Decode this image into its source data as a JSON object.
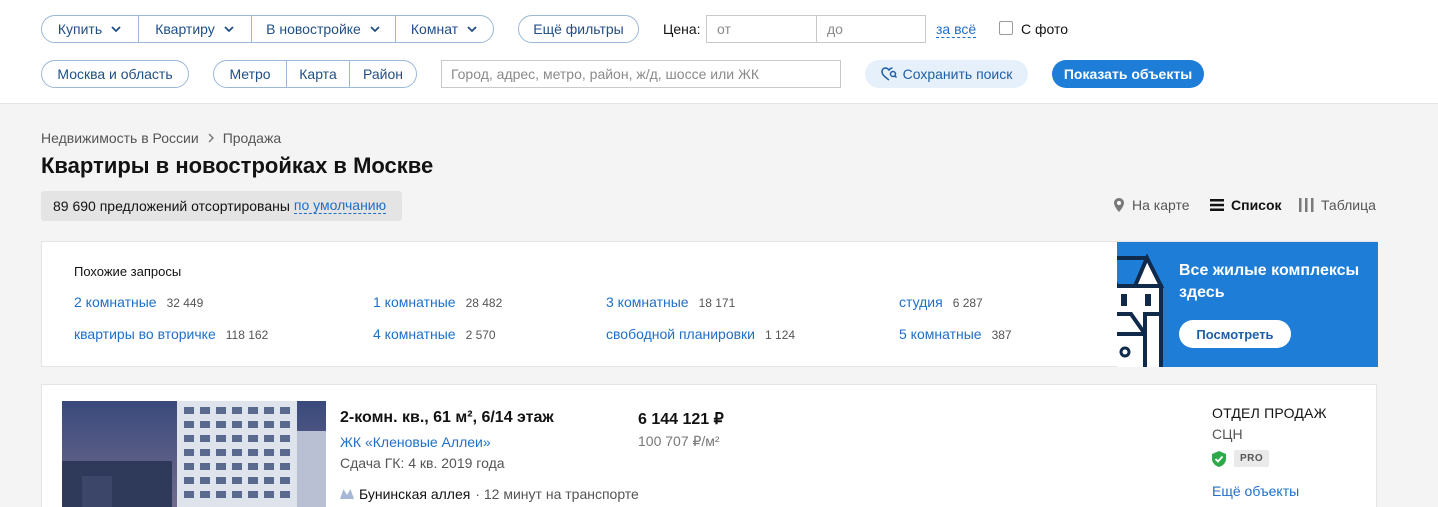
{
  "filters": {
    "deal": {
      "label": "Купить"
    },
    "type": {
      "label": "Квартиру"
    },
    "market": {
      "label": "В новостройке"
    },
    "rooms": {
      "label": "Комнат"
    },
    "more_filters": "Ещё фильтры",
    "price_label": "Цена:",
    "price_from_placeholder": "от",
    "price_to_placeholder": "до",
    "price_unit": "за всё",
    "photo_checkbox": {
      "label": "С фото",
      "checked": false
    },
    "region": "Москва и область",
    "geo_tabs": [
      "Метро",
      "Карта",
      "Район"
    ],
    "search_placeholder": "Город, адрес, метро, район, ж/д, шоссе или ЖК",
    "save_search": "Сохранить поиск",
    "show_objects": "Показать объекты"
  },
  "breadcrumb": [
    "Недвижимость в России",
    "Продажа"
  ],
  "page_title": "Квартиры в новостройках в Москве",
  "sort": {
    "text": "89 690 предложений отсортированы",
    "link": "по умолчанию"
  },
  "views": {
    "map": "На карте",
    "list": "Список",
    "table": "Таблица",
    "active": "list"
  },
  "similar": {
    "title": "Похожие запросы",
    "items": [
      {
        "label": "2 комнатные",
        "count": "32 449"
      },
      {
        "label": "1 комнатные",
        "count": "28 482"
      },
      {
        "label": "3 комнатные",
        "count": "18 171"
      },
      {
        "label": "студия",
        "count": "6 287"
      },
      {
        "label": "квартиры во вторичке",
        "count": "118 162"
      },
      {
        "label": "4 комнатные",
        "count": "2 570"
      },
      {
        "label": "свободной планировки",
        "count": "1 124"
      },
      {
        "label": "5 комнатные",
        "count": "387"
      }
    ]
  },
  "promo": {
    "text": "Все жилые комплексы здесь",
    "button": "Посмотреть"
  },
  "listing": {
    "title": "2-комн. кв., 61 м², 6/14 этаж",
    "complex": "ЖК «Кленовые Аллеи»",
    "deadline": "Сдача ГК: 4 кв. 2019 года",
    "metro_station": "Бунинская аллея",
    "metro_time": "· 12 минут на транспорте",
    "price": "6 144 121 ₽",
    "price_per_m2": "100 707 ₽/м²",
    "seller_name": "ОТДЕЛ ПРОДАЖ",
    "seller_org": "СЦН",
    "seller_badge": "PRO",
    "more_objects": "Ещё объекты"
  },
  "colors": {
    "accent": "#1e7dd7",
    "link": "#1f6fc8",
    "verified": "#2eaa4a"
  }
}
